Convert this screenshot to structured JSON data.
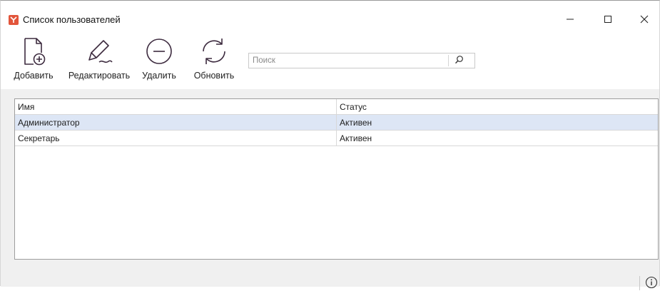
{
  "window": {
    "title": "Список пользователей",
    "app_icon": "app-logo-icon",
    "controls": {
      "minimize_icon": "minimize-icon",
      "maximize_icon": "maximize-icon",
      "close_icon": "close-icon"
    }
  },
  "toolbar": {
    "buttons": [
      {
        "id": "add",
        "label": "Добавить",
        "icon": "add-document-icon"
      },
      {
        "id": "edit",
        "label": "Редактировать",
        "icon": "pencil-icon"
      },
      {
        "id": "delete",
        "label": "Удалить",
        "icon": "minus-circle-icon"
      },
      {
        "id": "refresh",
        "label": "Обновить",
        "icon": "refresh-icon"
      }
    ],
    "search": {
      "placeholder": "Поиск",
      "value": "",
      "icon": "search-icon"
    }
  },
  "table": {
    "columns": [
      "Имя",
      "Статус"
    ],
    "rows": [
      {
        "name": "Администратор",
        "status": "Активен",
        "selected": true
      },
      {
        "name": "Секретарь",
        "status": "Активен",
        "selected": false
      }
    ]
  },
  "statusbar": {
    "info_icon": "info-icon"
  },
  "colors": {
    "app_icon": "#e2553b",
    "selected_row": "#dde6f5",
    "content_background": "#f0f0f0",
    "icon_stroke": "#3d2b3f"
  }
}
